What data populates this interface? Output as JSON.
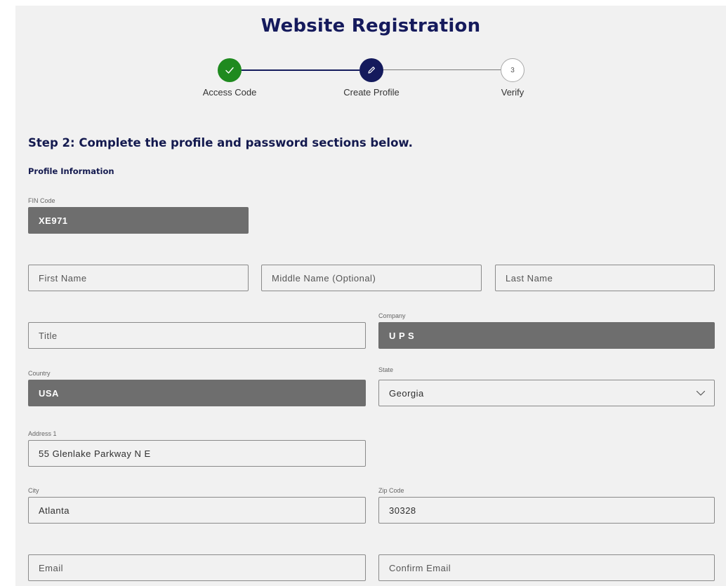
{
  "header": {
    "title": "Website Registration"
  },
  "stepper": {
    "steps": [
      {
        "label": "Access Code",
        "status": "complete"
      },
      {
        "label": "Create Profile",
        "status": "current"
      },
      {
        "label": "Verify",
        "status": "pending",
        "number": "3"
      }
    ]
  },
  "form": {
    "heading": "Step 2: Complete the profile and password sections below.",
    "section_title": "Profile Information",
    "fin_code": {
      "label": "FIN Code",
      "value": "XE971"
    },
    "first_name": {
      "placeholder": "First Name"
    },
    "middle_name": {
      "placeholder": "Middle Name (Optional)"
    },
    "last_name": {
      "placeholder": "Last Name"
    },
    "title": {
      "placeholder": "Title"
    },
    "company": {
      "label": "Company",
      "value": "U P S"
    },
    "country": {
      "label": "Country",
      "value": "USA"
    },
    "state": {
      "label": "State",
      "value": "Georgia"
    },
    "address1": {
      "label": "Address 1",
      "value": "55 Glenlake Parkway N E"
    },
    "city": {
      "label": "City",
      "value": "Atlanta"
    },
    "zip": {
      "label": "Zip Code",
      "value": "30328"
    },
    "email": {
      "placeholder": "Email"
    },
    "confirm_email": {
      "placeholder": "Confirm Email"
    }
  },
  "colors": {
    "brand_navy": "#141a5c",
    "step_complete": "#1f8a1f",
    "readonly_field": "#6e6e6e",
    "page_background": "#f1f1f1"
  }
}
